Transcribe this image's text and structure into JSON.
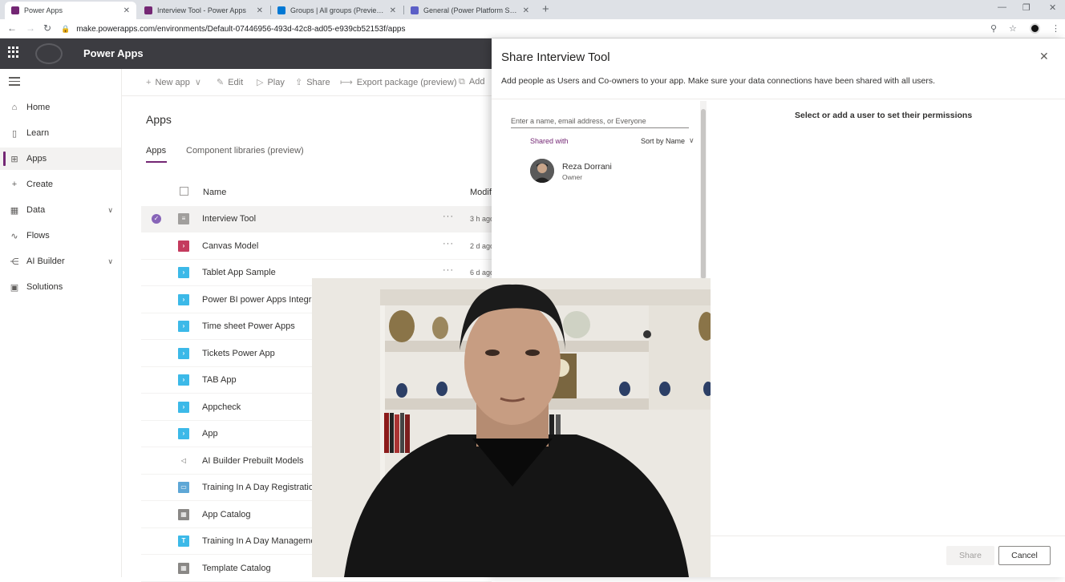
{
  "browser": {
    "tabs": [
      {
        "title": "Power Apps",
        "fav_color": "#742774",
        "active": true
      },
      {
        "title": "Interview Tool - Power Apps",
        "fav_color": "#742774",
        "active": false
      },
      {
        "title": "Groups | All groups (Preview) - M",
        "fav_color": "#0078d4",
        "active": false
      },
      {
        "title": "General (Power Platform Share) |",
        "fav_color": "#5b5fc7",
        "active": false
      }
    ],
    "url": "make.powerapps.com/environments/Default-07446956-493d-42c8-ad05-e939cb52153f/apps"
  },
  "header": {
    "title": "Power Apps"
  },
  "leftnav": {
    "items": [
      {
        "label": "Home",
        "icon": "home-icon"
      },
      {
        "label": "Learn",
        "icon": "book-icon"
      },
      {
        "label": "Apps",
        "icon": "apps-icon",
        "active": true
      },
      {
        "label": "Create",
        "icon": "plus-icon"
      },
      {
        "label": "Data",
        "icon": "table-icon",
        "expandable": true
      },
      {
        "label": "Flows",
        "icon": "flow-icon"
      },
      {
        "label": "AI Builder",
        "icon": "ai-icon",
        "expandable": true
      },
      {
        "label": "Solutions",
        "icon": "solutions-icon"
      }
    ]
  },
  "commandbar": {
    "new_app": "New app",
    "edit": "Edit",
    "play": "Play",
    "share": "Share",
    "export": "Export package (preview)",
    "add": "Add"
  },
  "main": {
    "heading": "Apps",
    "pivots": [
      "Apps",
      "Component libraries (preview)"
    ],
    "columns": {
      "name": "Name",
      "modified": "Modified"
    },
    "rows": [
      {
        "name": "Interview Tool",
        "modified": "3 h ago",
        "icon_color": "#a19f9d",
        "glyph": "≡",
        "selected": true,
        "dots": true
      },
      {
        "name": "Canvas Model",
        "modified": "2 d ago",
        "icon_color": "#c43b5e",
        "glyph": "›",
        "dots": true
      },
      {
        "name": "Tablet App Sample",
        "modified": "6 d ago",
        "icon_color": "#3cb9e8",
        "glyph": "›",
        "dots": true
      },
      {
        "name": "Power BI power Apps Integration",
        "modified": "",
        "icon_color": "#3cb9e8",
        "glyph": "›"
      },
      {
        "name": "Time sheet Power Apps",
        "modified": "",
        "icon_color": "#3cb9e8",
        "glyph": "›"
      },
      {
        "name": "Tickets Power App",
        "modified": "",
        "icon_color": "#3cb9e8",
        "glyph": "›"
      },
      {
        "name": "TAB App",
        "modified": "",
        "icon_color": "#3cb9e8",
        "glyph": "›"
      },
      {
        "name": "Appcheck",
        "modified": "",
        "icon_color": "#3cb9e8",
        "glyph": "›"
      },
      {
        "name": "App",
        "modified": "",
        "icon_color": "#3cb9e8",
        "glyph": "›"
      },
      {
        "name": "AI Builder Prebuilt Models",
        "modified": "",
        "icon_color": "#ffffff",
        "glyph": "◁"
      },
      {
        "name": "Training In A Day Registration",
        "modified": "",
        "icon_color": "#5ea7d6",
        "glyph": "▭"
      },
      {
        "name": "App Catalog",
        "modified": "",
        "icon_color": "#8a8886",
        "glyph": "▦"
      },
      {
        "name": "Training In A Day Management",
        "modified": "",
        "icon_color": "#3cb9e8",
        "glyph": "T"
      },
      {
        "name": "Template Catalog",
        "modified": "",
        "icon_color": "#8a8886",
        "glyph": "▦"
      }
    ]
  },
  "panel": {
    "title": "Share Interview Tool",
    "description": "Add people as Users and Co-owners to your app. Make sure your data connections have been shared with all users.",
    "search_placeholder": "Enter a name, email address, or Everyone",
    "shared_with": "Shared with",
    "sort_by": "Sort by Name",
    "user": {
      "name": "Reza Dorrani",
      "role": "Owner"
    },
    "permissions_hint": "Select or add a user to set their permissions",
    "share_label": "Share",
    "cancel_label": "Cancel"
  },
  "colors": {
    "accent": "#742774",
    "header_bg": "#3c3c41"
  }
}
